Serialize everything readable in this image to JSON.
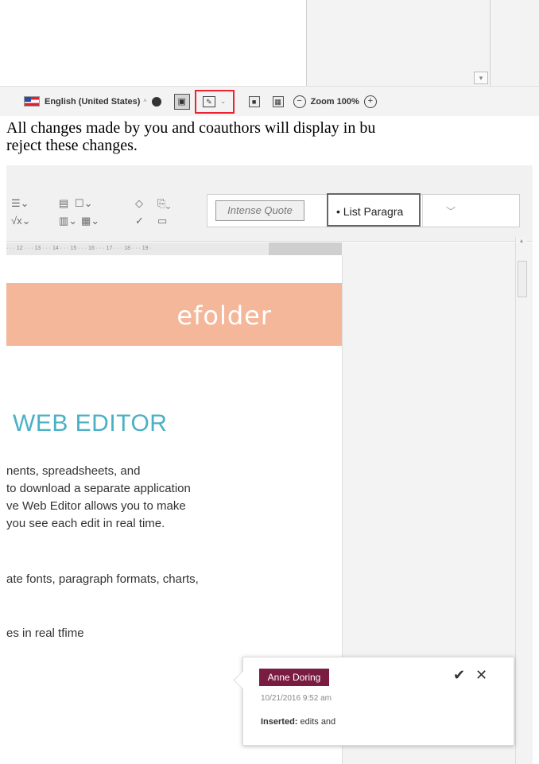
{
  "statusbar": {
    "language": "English (United States)",
    "zoom_label": "Zoom 100%"
  },
  "instruction": {
    "line1": "All changes made by you and coauthors will display in bu",
    "line2": "reject these changes."
  },
  "ribbon": {
    "style_intense": "Intense Quote",
    "style_list": "• List Paragra"
  },
  "ruler": {
    "ticks": "· · · 12 · · · 13 · · · 14 · · · 15 · · · 16 · · · 17 · · · 18 · · · 19 ·"
  },
  "document": {
    "brand": "efolder",
    "title": "WEB EDITOR",
    "lines": [
      "nents, spreadsheets, and",
      " to download a separate application",
      "ve Web Editor allows you to make",
      " you see each edit in real time.",
      "ate fonts, paragraph formats, charts,",
      "es in real tfime"
    ]
  },
  "comment": {
    "author": "Anne Doring",
    "timestamp": "10/21/2016 9:52 am",
    "type": "Inserted:",
    "text": " edits and"
  },
  "colors": {
    "highlight": "#e22233",
    "banner": "#f4b79a",
    "title": "#4bb0c6",
    "author_badge": "#7a1c42"
  }
}
